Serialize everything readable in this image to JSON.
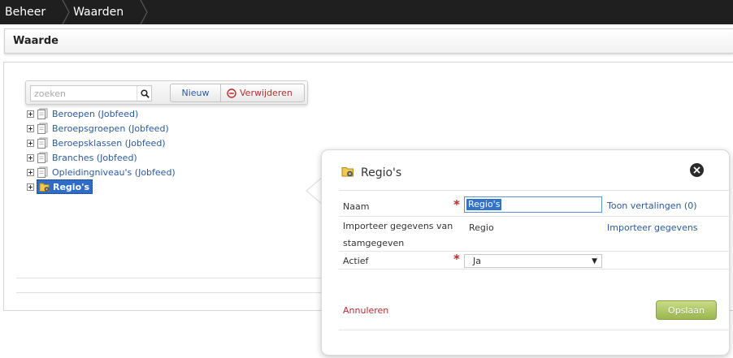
{
  "breadcrumb": [
    "Beheer",
    "Waarden"
  ],
  "page_title": "Waarde",
  "toolbar": {
    "search_placeholder": "zoeken",
    "new_label": "Nieuw",
    "delete_label": "Verwijderen"
  },
  "tree": {
    "items": [
      {
        "label": "Beroepen (Jobfeed)"
      },
      {
        "label": "Beroepsgroepen (Jobfeed)"
      },
      {
        "label": "Beroepsklassen (Jobfeed)"
      },
      {
        "label": "Branches (Jobfeed)"
      },
      {
        "label": "Opleidingniveau's (Jobfeed)"
      },
      {
        "label": "Regio's"
      }
    ],
    "selected": "Regio's"
  },
  "popover": {
    "title": "Regio's",
    "fields": {
      "naam_label": "Naam",
      "naam_value": "Regio's",
      "show_translations": "Toon vertalingen (0)",
      "import_label": "Importeer gegevens van stamgegeven",
      "import_value": "Regio",
      "import_link": "Importeer gegevens",
      "actief_label": "Actief",
      "actief_value": "Ja"
    },
    "required_marker": "*",
    "cancel_label": "Annuleren",
    "save_label": "Opslaan"
  },
  "colors": {
    "topbar": "#1f1f1f",
    "link": "#2a5a9e",
    "cancel": "#b23030",
    "save_button": "#9bb74f",
    "selection": "#2f6cc7"
  }
}
